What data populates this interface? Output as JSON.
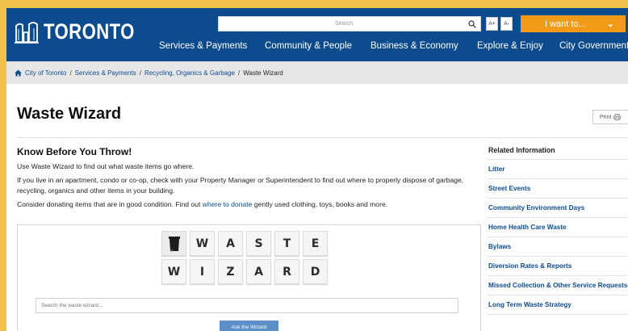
{
  "header": {
    "logo_text": "TORONTO",
    "search_placeholder": "Search",
    "font_increase": "A+",
    "font_decrease": "A-",
    "iwant_label": "I want to...",
    "nav": [
      "Services & Payments",
      "Community & People",
      "Business & Economy",
      "Explore & Enjoy",
      "City Government"
    ]
  },
  "breadcrumb": {
    "items": [
      "City of Toronto",
      "Services & Payments",
      "Recycling, Organics & Garbage"
    ],
    "current": "Waste Wizard"
  },
  "page": {
    "title": "Waste Wizard",
    "print_label": "Print"
  },
  "content": {
    "heading": "Know Before You Throw!",
    "para1": "Use Waste Wizard to find out what waste items go where.",
    "para2": "If you live in an apartment, condo or co-op, check with your Property Manager or Superintendent to find out where to properly dispose of garbage, recycling, organics and other items in your building.",
    "para3_before": "Consider donating items that are in good condition. Find out ",
    "para3_link": "where to donate",
    "para3_after": " gently used clothing, toys, books and more."
  },
  "wizard": {
    "row1": [
      "W",
      "A",
      "S",
      "T",
      "E"
    ],
    "row2": [
      "W",
      "I",
      "Z",
      "A",
      "R",
      "D"
    ],
    "search_placeholder": "Search the waste wizard...",
    "button_label": "Ask the Wizard"
  },
  "sidebar": {
    "heading": "Related Information",
    "links": [
      "Litter",
      "Street Events",
      "Community Environment Days",
      "Home Health Care Waste",
      "Bylaws",
      "Diversion Rates & Reports",
      "Missed Collection & Other Service Requests",
      "Long Term Waste Strategy"
    ]
  },
  "colors": {
    "header_blue": "#0c4b8e",
    "accent_orange": "#f29b18",
    "page_border_yellow": "#f0c24a"
  }
}
